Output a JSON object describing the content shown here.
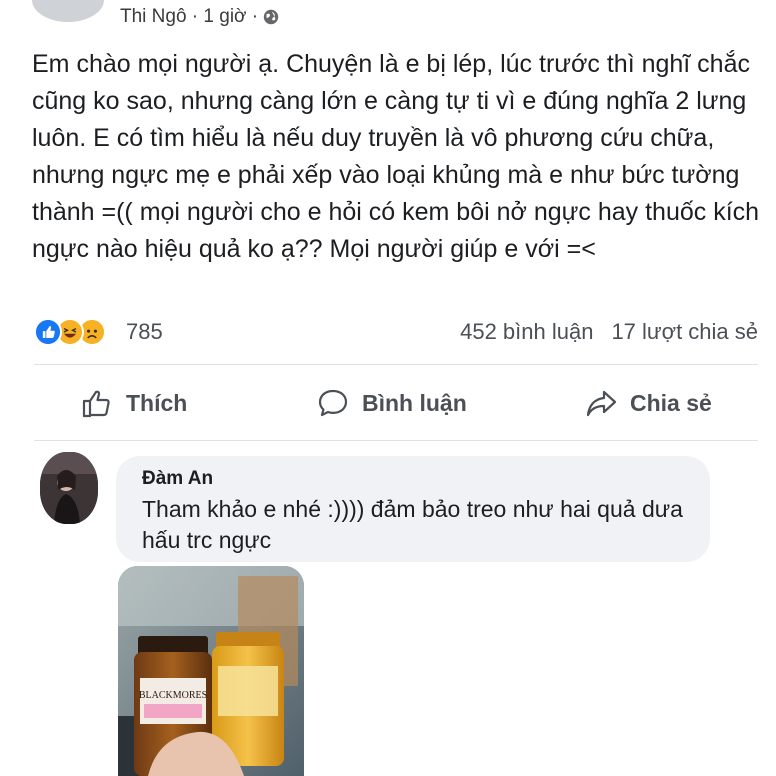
{
  "post": {
    "author_meta": "Thi Ngô · 1 giờ ·",
    "body": "Em chào mọi người ạ. Chuyện là e bị lép, lúc trước thì nghĩ chắc cũng ko sao, nhưng càng lớn e càng tự ti vì e đúng nghĩa 2 lưng luôn. E có tìm hiểu là nếu duy truyền là vô phương cứu chữa, nhưng ngực mẹ e phải xếp vào loại khủng mà e như bức tường thành =(( mọi người cho e hỏi có kem bôi nở ngực hay thuốc kích ngực nào hiệu quả ko ạ?? Mọi người giúp e với =<",
    "reaction_count": "785",
    "comments_count": "452 bình luận",
    "shares_count": "17 lượt chia sẻ",
    "reaction_icons": [
      "like-icon",
      "haha-icon",
      "sad-icon"
    ]
  },
  "actions": {
    "like_label": "Thích",
    "comment_label": "Bình luận",
    "share_label": "Chia sẻ"
  },
  "comment": {
    "author": "Đàm An",
    "text": "Tham khảo e nhé :)))) đảm bảo treo như hai quả dưa hấu trc ngực",
    "photo_label": "BLACKMORES"
  },
  "colors": {
    "like_blue": "#1877f2",
    "emoji_yellow": "#f7b125",
    "bubble_bg": "#f0f2f5",
    "secondary_text": "#4b4f56"
  }
}
